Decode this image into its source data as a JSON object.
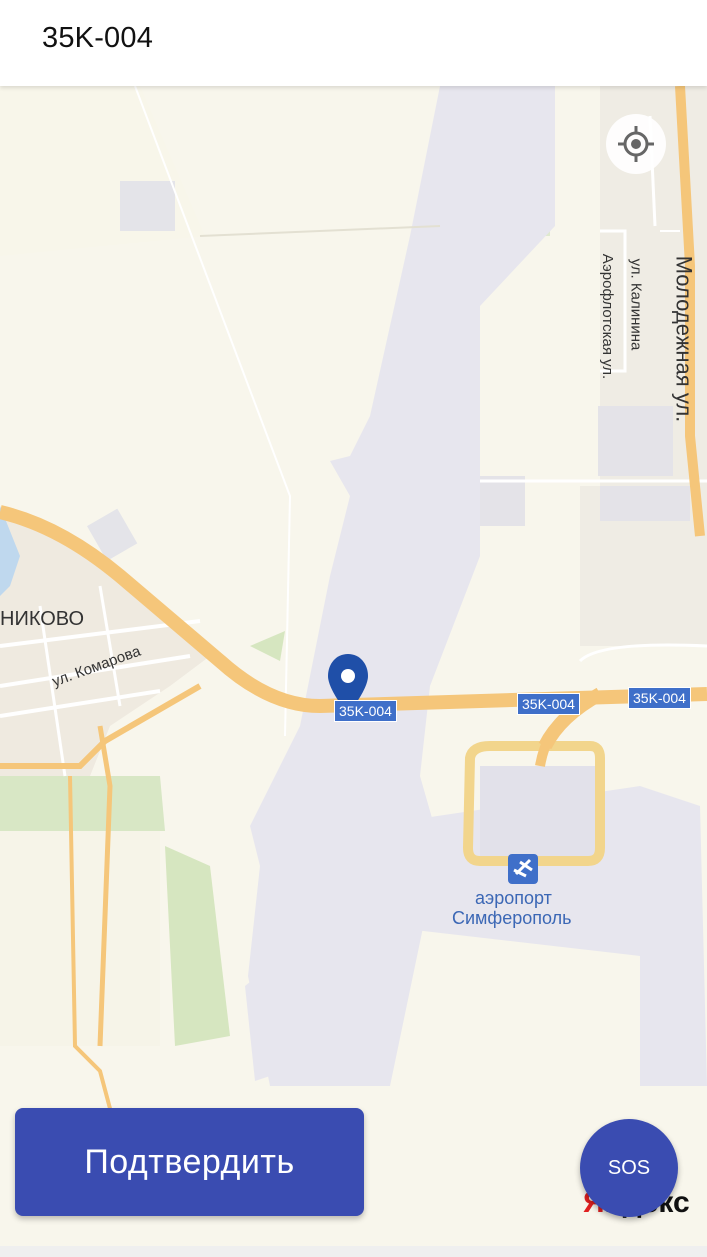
{
  "header": {
    "title": "35K-004"
  },
  "map": {
    "labels": {
      "village": "НИКОВО",
      "street_komarova": "ул. Комарова",
      "street_kalinina": "ул. Калинина",
      "street_aeroflot": "Аэрофлотская ул.",
      "street_molodezhnaya": "Молодежная ул.",
      "airport_line1": "аэропорт",
      "airport_line2": "Симферополь"
    },
    "road_badges": [
      "35K-004",
      "35K-004",
      "35K-004"
    ],
    "provider_logo": {
      "first_letter": "Я",
      "rest": "ндекс"
    }
  },
  "actions": {
    "confirm_label": "Подтвердить",
    "sos_label": "SOS"
  },
  "colors": {
    "accent": "#3a4cb1",
    "road": "#f5c67a",
    "runway": "#e8e8ee",
    "pin": "#1f4fa8"
  }
}
